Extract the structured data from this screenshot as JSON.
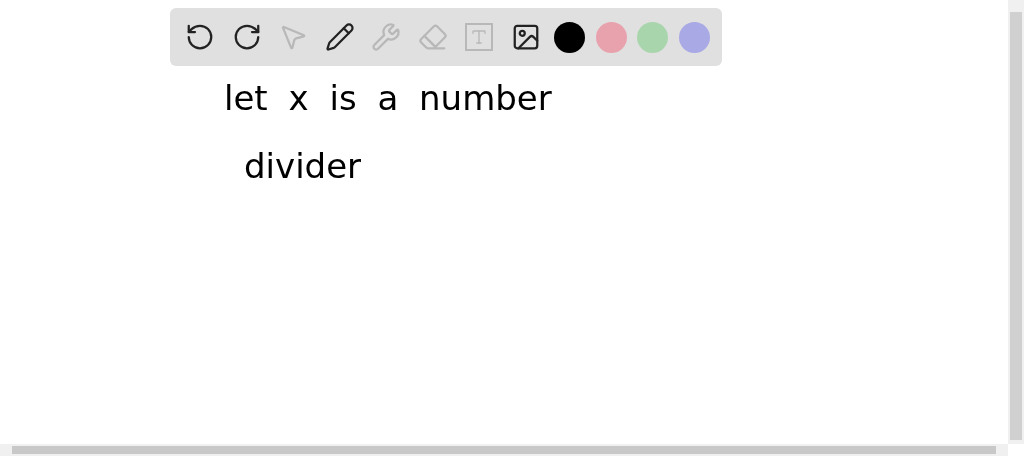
{
  "toolbar": {
    "tools": [
      {
        "kind": "undo",
        "disabled": false
      },
      {
        "kind": "redo",
        "disabled": false
      },
      {
        "kind": "select",
        "disabled": true
      },
      {
        "kind": "pen",
        "disabled": false
      },
      {
        "kind": "tools",
        "disabled": true
      },
      {
        "kind": "eraser",
        "disabled": true
      },
      {
        "kind": "text",
        "disabled": true
      },
      {
        "kind": "image",
        "disabled": false
      }
    ],
    "colors": [
      {
        "color": "#000000"
      },
      {
        "color": "#e8a2ae"
      },
      {
        "color": "#a9d5ad"
      },
      {
        "color": "#a9a9e6"
      }
    ]
  },
  "canvas": {
    "lines": [
      "let x is a number",
      "divider"
    ]
  }
}
